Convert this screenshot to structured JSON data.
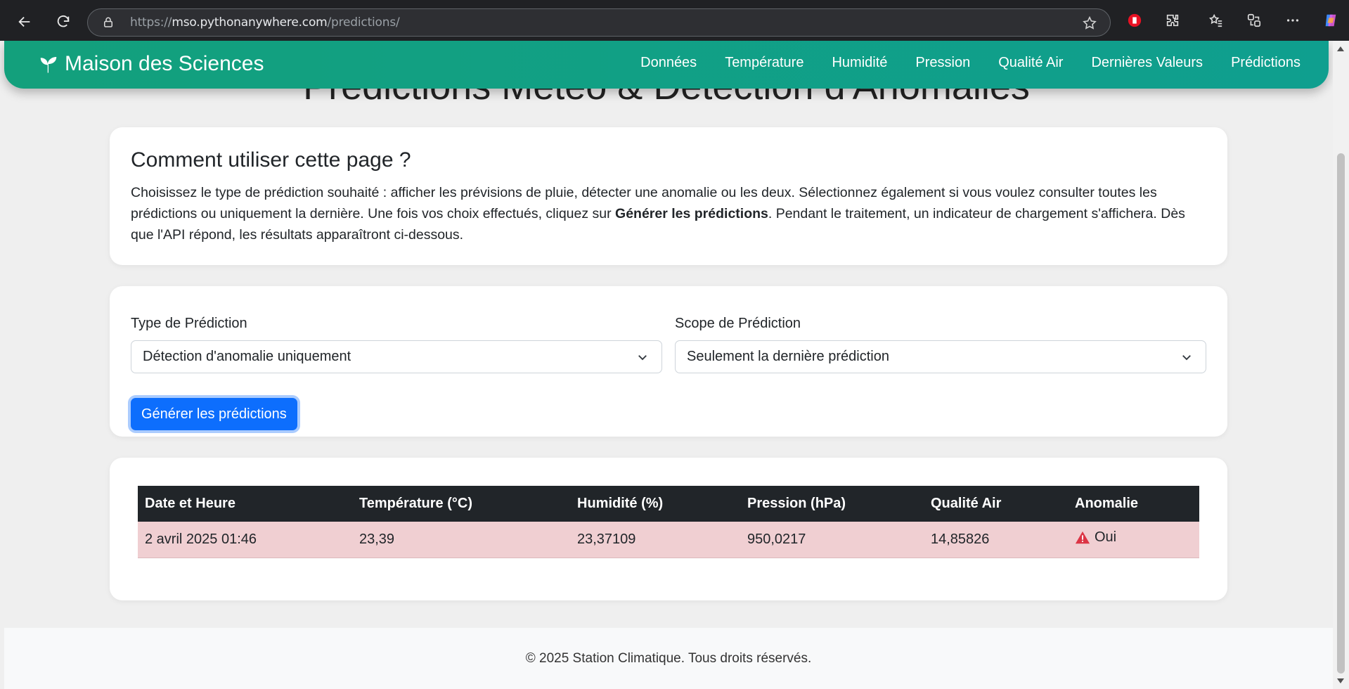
{
  "browser": {
    "url_scheme": "https://",
    "url_host": "mso.pythonanywhere.com",
    "url_path": "/predictions/"
  },
  "navbar": {
    "brand": "Maison des Sciences",
    "links": [
      "Données",
      "Température",
      "Humidité",
      "Pression",
      "Qualité Air",
      "Dernières Valeurs",
      "Prédictions"
    ]
  },
  "page": {
    "title": "Prédictions Météo & Détection d'Anomalies"
  },
  "help": {
    "heading": "Comment utiliser cette page ?",
    "text_before": "Choisissez le type de prédiction souhaité : afficher les prévisions de pluie, détecter une anomalie ou les deux. Sélectionnez également si vous voulez consulter toutes les prédictions ou uniquement la dernière. Une fois vos choix effectués, cliquez sur ",
    "text_bold": "Générer les prédictions",
    "text_after": ". Pendant le traitement, un indicateur de chargement s'affichera. Dès que l'API répond, les résultats apparaîtront ci-dessous."
  },
  "form": {
    "type_label": "Type de Prédiction",
    "type_value": "Détection d'anomalie uniquement",
    "scope_label": "Scope de Prédiction",
    "scope_value": "Seulement la dernière prédiction",
    "submit_label": "Générer les prédictions"
  },
  "results": {
    "headers": [
      "Date et Heure",
      "Température (°C)",
      "Humidité (%)",
      "Pression (hPa)",
      "Qualité Air",
      "Anomalie"
    ],
    "rows": [
      [
        "2 avril 2025 01:46",
        "23,39",
        "23,37109",
        "950,0217",
        "14,85826",
        "Oui"
      ]
    ]
  },
  "footer": {
    "text": "© 2025 Station Climatique. Tous droits réservés."
  },
  "colors": {
    "navbar": "#13a07c",
    "button": "#0d6efd",
    "anomaly_row": "#f0cfd2",
    "table_header": "#212529",
    "warning": "#dc3545"
  }
}
